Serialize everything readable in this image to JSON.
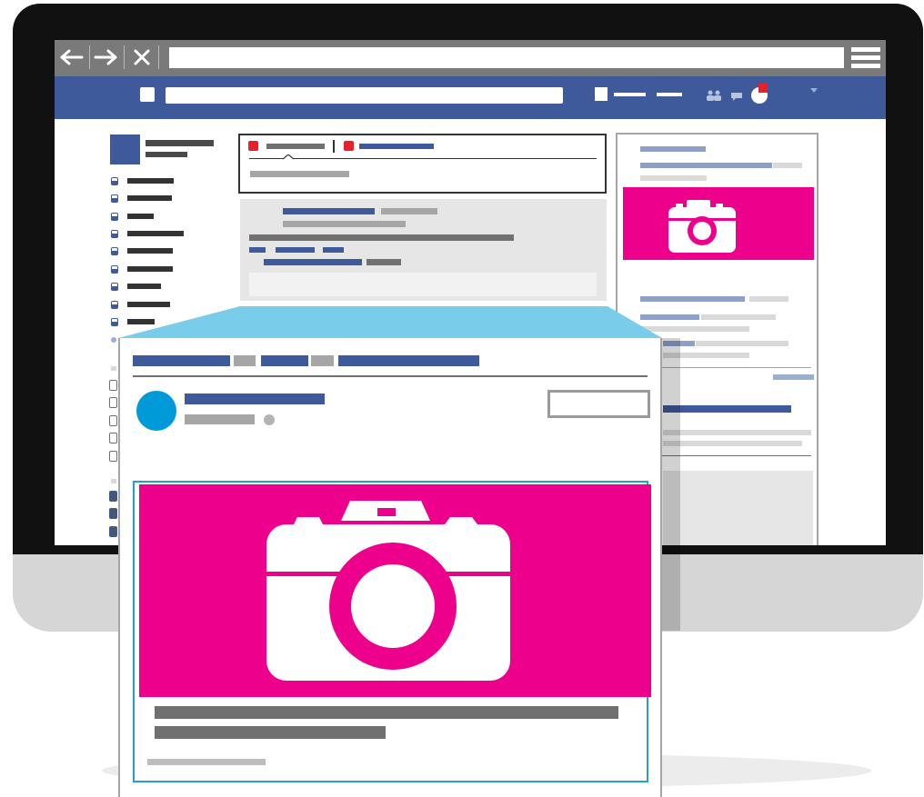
{
  "browser": {
    "back_icon": "arrow-left-icon",
    "forward_icon": "arrow-right-icon",
    "close_icon": "close-icon",
    "menu_icon": "hamburger-menu-icon"
  },
  "colors": {
    "accent_magenta": "#ec008c",
    "brand_blue": "#3f5a9a",
    "avatar_blue": "#009ad9",
    "zoom_highlight": "#79cdea"
  },
  "icons": {
    "photo": "camera-icon",
    "friends": "friends-icon",
    "messages": "messages-icon",
    "notifications": "notifications-icon",
    "dropdown": "caret-down-icon"
  }
}
